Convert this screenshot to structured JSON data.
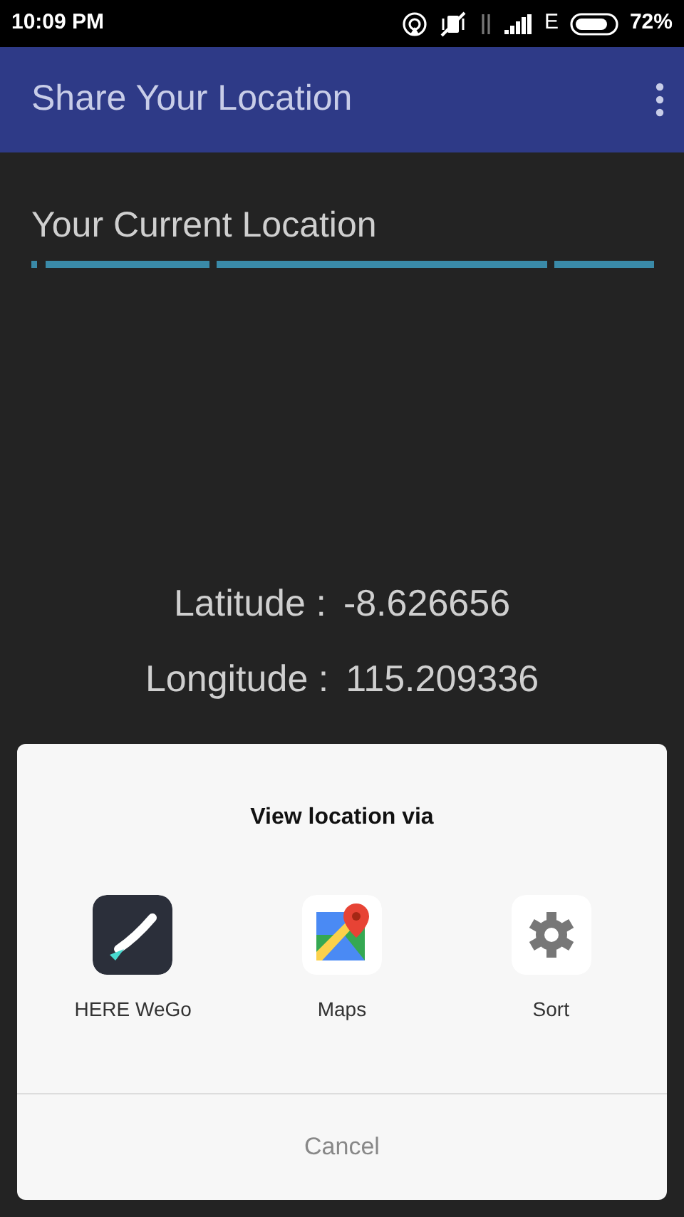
{
  "status_bar": {
    "time": "10:09 PM",
    "network": "E",
    "battery": "72%"
  },
  "app_bar": {
    "title": "Share Your Location"
  },
  "section": {
    "title": "Your Current Location"
  },
  "coordinates": [
    {
      "label": "Latitude :",
      "value": "-8.626656"
    },
    {
      "label": "Longitude :",
      "value": "115.209336"
    }
  ],
  "dialog": {
    "title": "View location via",
    "apps": [
      {
        "kind": "here",
        "label": "HERE WeGo"
      },
      {
        "kind": "maps",
        "label": "Maps"
      },
      {
        "kind": "settings",
        "label": "Sort"
      }
    ],
    "cancel": "Cancel"
  }
}
